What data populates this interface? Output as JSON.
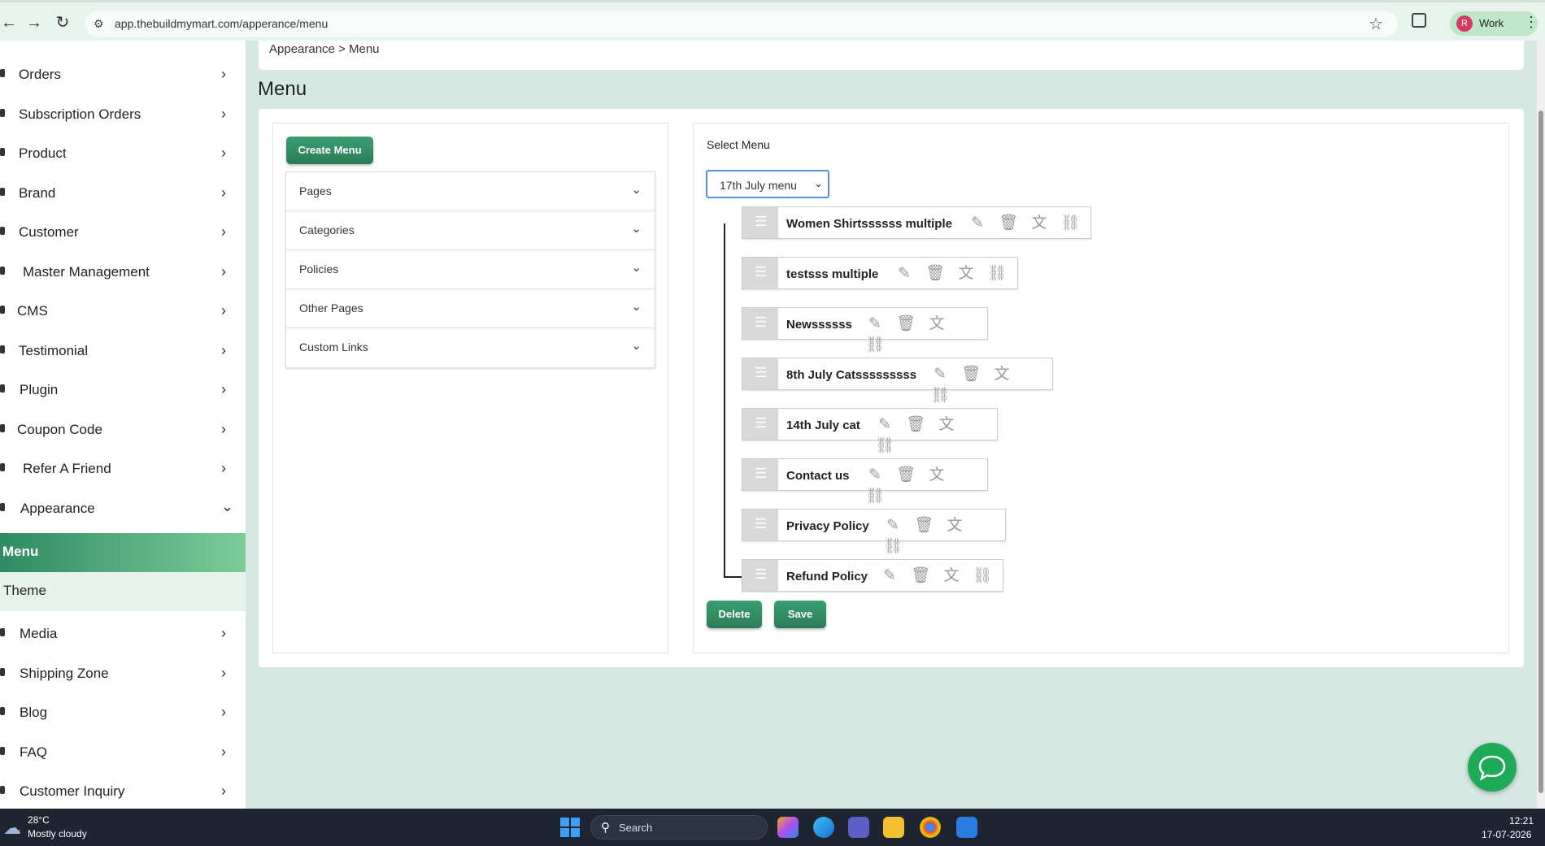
{
  "browser": {
    "url": "app.thebuildmymart.com/apperance/menu",
    "profile_initial": "R",
    "profile_name": "Work"
  },
  "sidebar": {
    "items": [
      {
        "label": "Orders"
      },
      {
        "label": "Subscription Orders"
      },
      {
        "label": "Product"
      },
      {
        "label": "Brand"
      },
      {
        "label": "Customer"
      },
      {
        "label": "Master Management"
      },
      {
        "label": "CMS"
      },
      {
        "label": "Testimonial"
      },
      {
        "label": "Plugin"
      },
      {
        "label": "Coupon Code"
      },
      {
        "label": "Refer A Friend"
      },
      {
        "label": "Appearance"
      },
      {
        "label": "Menu"
      },
      {
        "label": "Theme"
      },
      {
        "label": "Media"
      },
      {
        "label": "Shipping Zone"
      },
      {
        "label": "Blog"
      },
      {
        "label": "FAQ"
      },
      {
        "label": "Customer Inquiry"
      }
    ]
  },
  "breadcrumb": "Appearance > Menu",
  "page_title": "Menu",
  "left_panel": {
    "create_button": "Create Menu",
    "sections": [
      {
        "label": "Pages"
      },
      {
        "label": "Categories"
      },
      {
        "label": "Policies"
      },
      {
        "label": "Other Pages"
      },
      {
        "label": "Custom Links"
      }
    ]
  },
  "right_panel": {
    "select_label": "Select Menu",
    "selected_menu": "17th July menu",
    "items": [
      {
        "label": "Women Shirtssssss multiple"
      },
      {
        "label": "testsss multiple"
      },
      {
        "label": "Newssssss"
      },
      {
        "label": "8th July Catsssssssss"
      },
      {
        "label": "14th July cat"
      },
      {
        "label": "Contact us"
      },
      {
        "label": "Privacy Policy"
      },
      {
        "label": "Refund Policy"
      }
    ],
    "delete_button": "Delete",
    "save_button": "Save"
  },
  "taskbar": {
    "temperature": "28°C",
    "weather": "Mostly cloudy",
    "search_placeholder": "Search",
    "time": "12:21",
    "date": "17-07-2026"
  },
  "colors": {
    "accent": "#2e8b63",
    "accent_light": "#7ccc98",
    "page_bg": "#d6e8e2",
    "chat": "#1eaa57"
  }
}
